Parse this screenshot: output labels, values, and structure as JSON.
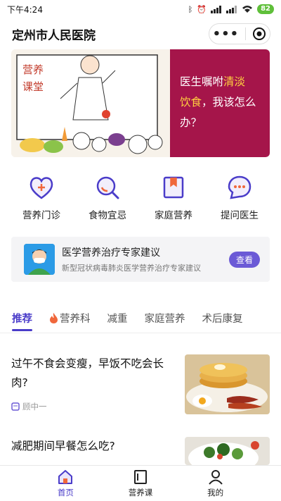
{
  "status_bar": {
    "time": "下午4:24",
    "battery": "82"
  },
  "header": {
    "title": "定州市人民医院"
  },
  "banner": {
    "line1_prefix": "医生嘱咐",
    "line1_highlight": "清淡",
    "line2_highlight": "饮食",
    "line2_suffix": "，我该怎么",
    "line3": "办？",
    "illustration_sign": [
      "营养",
      "课堂"
    ]
  },
  "quick_actions": [
    {
      "label": "营养门诊",
      "icon": "heart-plus-icon"
    },
    {
      "label": "食物宜忌",
      "icon": "magnifier-icon"
    },
    {
      "label": "家庭营养",
      "icon": "bookmark-icon"
    },
    {
      "label": "提问医生",
      "icon": "chat-bubble-icon"
    }
  ],
  "notice_card": {
    "title": "医学营养治疗专家建议",
    "subtitle": "新型冠状病毒肺炎医学营养治疗专家建议",
    "button": "查看"
  },
  "tabs": [
    {
      "label": "推荐",
      "active": true
    },
    {
      "label": "营养科",
      "icon": "flame-icon"
    },
    {
      "label": "减重"
    },
    {
      "label": "家庭营养"
    },
    {
      "label": "术后康复"
    }
  ],
  "articles": [
    {
      "title": "过午不食会变瘦，早饭不吃会长肉?",
      "author": "顾中一"
    },
    {
      "title": "减肥期间早餐怎么吃?",
      "author": ""
    }
  ],
  "tab_bar": [
    {
      "label": "首页",
      "active": true
    },
    {
      "label": "营养课"
    },
    {
      "label": "我的"
    }
  ],
  "colors": {
    "accent": "#4a3cc9",
    "banner_bg": "#a5154a",
    "highlight": "#ffd23f"
  }
}
